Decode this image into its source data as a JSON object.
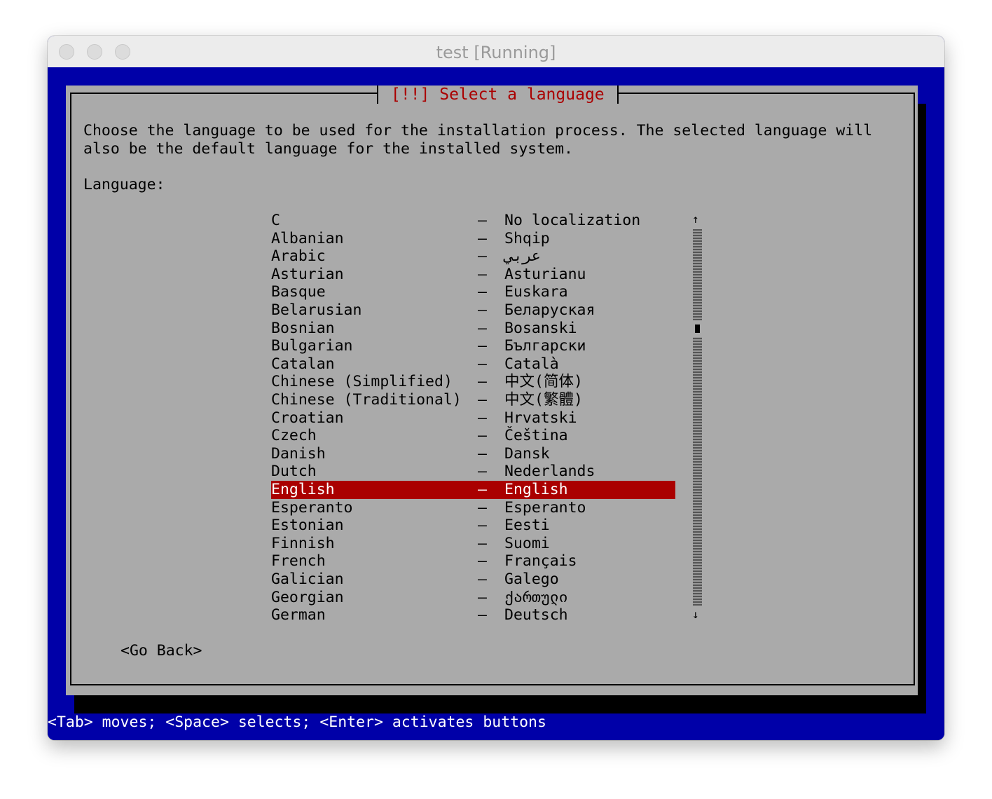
{
  "window": {
    "title": "test [Running]"
  },
  "dialog": {
    "title": "[!!] Select a language",
    "description_line1": "Choose the language to be used for the installation process. The selected language will",
    "description_line2": "also be the default language for the installed system.",
    "list_label": "Language:",
    "go_back_label": "<Go Back>",
    "selected_language": "English",
    "languages": [
      {
        "english": "C",
        "native": "No localization"
      },
      {
        "english": "Albanian",
        "native": "Shqip"
      },
      {
        "english": "Arabic",
        "native": "عربي"
      },
      {
        "english": "Asturian",
        "native": "Asturianu"
      },
      {
        "english": "Basque",
        "native": "Euskara"
      },
      {
        "english": "Belarusian",
        "native": "Беларуская"
      },
      {
        "english": "Bosnian",
        "native": "Bosanski"
      },
      {
        "english": "Bulgarian",
        "native": "Български"
      },
      {
        "english": "Catalan",
        "native": "Català"
      },
      {
        "english": "Chinese (Simplified)",
        "native": "中文(简体)"
      },
      {
        "english": "Chinese (Traditional)",
        "native": "中文(繁體)"
      },
      {
        "english": "Croatian",
        "native": "Hrvatski"
      },
      {
        "english": "Czech",
        "native": "Čeština"
      },
      {
        "english": "Danish",
        "native": "Dansk"
      },
      {
        "english": "Dutch",
        "native": "Nederlands"
      },
      {
        "english": "English",
        "native": "English"
      },
      {
        "english": "Esperanto",
        "native": "Esperanto"
      },
      {
        "english": "Estonian",
        "native": "Eesti"
      },
      {
        "english": "Finnish",
        "native": "Suomi"
      },
      {
        "english": "French",
        "native": "Français"
      },
      {
        "english": "Galician",
        "native": "Galego"
      },
      {
        "english": "Georgian",
        "native": "ქართული"
      },
      {
        "english": "German",
        "native": "Deutsch"
      }
    ],
    "separator": "–",
    "scroll_up_icon": "arrow-up",
    "scroll_down_icon": "arrow-down"
  },
  "helpbar": {
    "text": "<Tab> moves; <Space> selects; <Enter> activates buttons"
  },
  "colors": {
    "screen_bg": "#0000a8",
    "dialog_bg": "#aaaaaa",
    "title_red": "#aa0000",
    "selection_bg": "#aa0000"
  }
}
